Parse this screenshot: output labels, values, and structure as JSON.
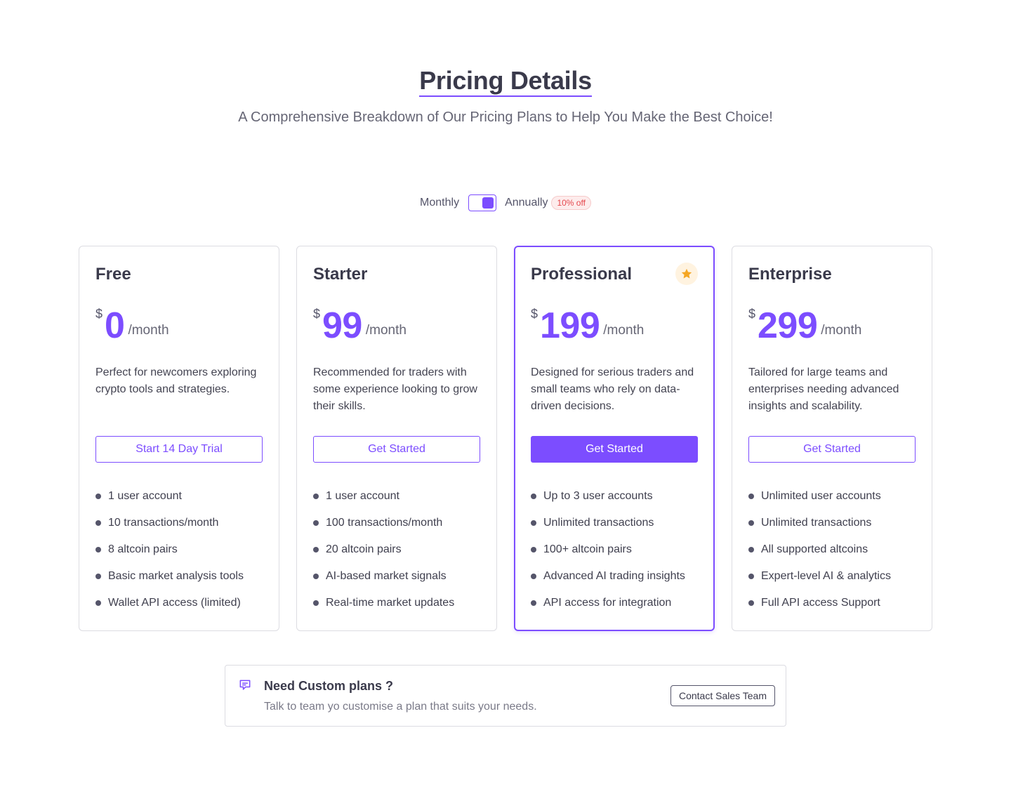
{
  "header": {
    "title": "Pricing Details",
    "subtitle": "A Comprehensive Breakdown of Our Pricing Plans to Help You Make the Best Choice!"
  },
  "billing": {
    "monthly_label": "Monthly",
    "annual_label": "Annually",
    "discount_badge": "10% off",
    "selected": "Annually"
  },
  "plans": [
    {
      "name": "Free",
      "currency": "$",
      "amount": "0",
      "period": "/month",
      "description": "Perfect for newcomers exploring crypto tools and strategies.",
      "cta": "Start 14 Day Trial",
      "features": [
        "1 user account",
        "10 transactions/month",
        "8 altcoin pairs",
        "Basic market analysis tools",
        "Wallet API access (limited)"
      ]
    },
    {
      "name": "Starter",
      "currency": "$",
      "amount": "99",
      "period": "/month",
      "description": "Recommended for traders with some experience looking to grow their skills.",
      "cta": "Get Started",
      "features": [
        "1 user account",
        "100 transactions/month",
        "20 altcoin pairs",
        "AI-based market signals",
        "Real-time market updates"
      ]
    },
    {
      "name": "Professional",
      "currency": "$",
      "amount": "199",
      "period": "/month",
      "description": "Designed for serious traders and small teams who rely on data-driven decisions.",
      "cta": "Get Started",
      "featured": true,
      "features": [
        "Up to 3 user accounts",
        "Unlimited transactions",
        "100+ altcoin pairs",
        "Advanced AI trading insights",
        "API access for integration"
      ]
    },
    {
      "name": "Enterprise",
      "currency": "$",
      "amount": "299",
      "period": "/month",
      "description": "Tailored for large teams and enterprises needing advanced insights and scalability.",
      "cta": "Get Started",
      "features": [
        "Unlimited user accounts",
        "Unlimited transactions",
        "All supported altcoins",
        "Expert-level AI & analytics",
        "Full API access Support"
      ]
    }
  ],
  "custom_plan": {
    "title": "Need Custom plans ?",
    "subtitle": "Talk to team yo customise a plan that suits your needs.",
    "cta": "Contact Sales Team"
  },
  "colors": {
    "accent": "#7c4dff",
    "star": "#f5a623",
    "badge_text": "#e5484d"
  },
  "icons": {
    "featured": "star-icon",
    "custom": "chat-icon"
  }
}
